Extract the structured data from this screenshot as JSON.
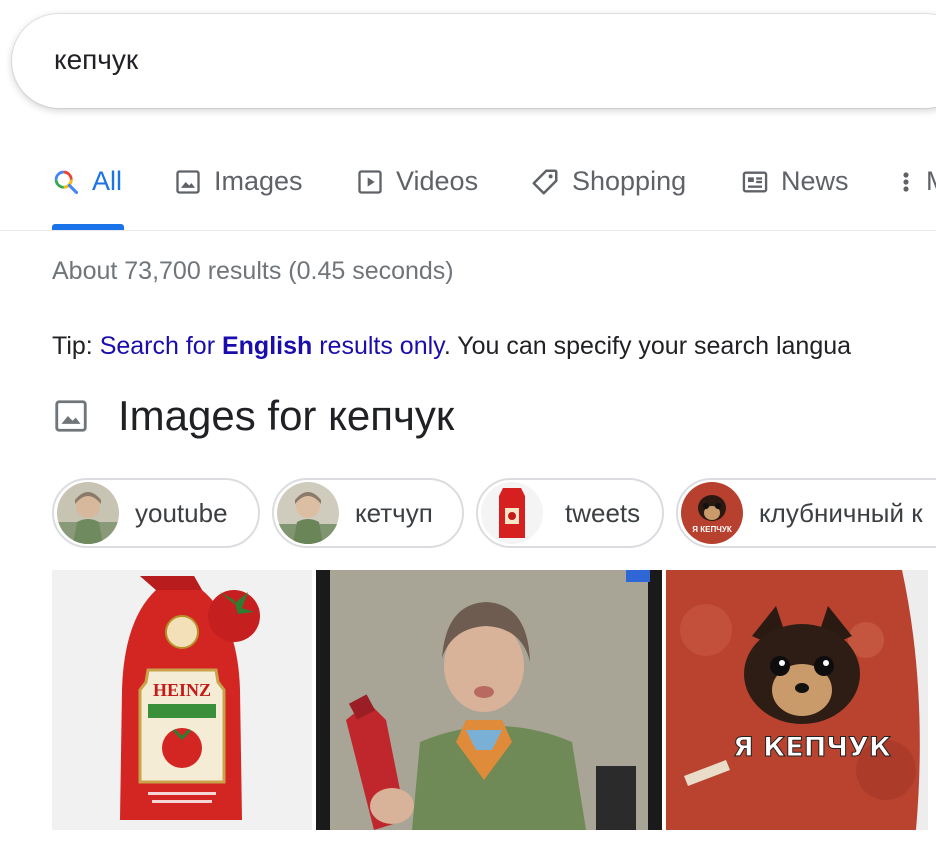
{
  "search": {
    "query": "кепчук"
  },
  "tabs": [
    {
      "label": "All",
      "icon": "search-icon",
      "active": true
    },
    {
      "label": "Images",
      "icon": "image-icon"
    },
    {
      "label": "Videos",
      "icon": "video-icon"
    },
    {
      "label": "Shopping",
      "icon": "tag-icon"
    },
    {
      "label": "News",
      "icon": "news-icon"
    },
    {
      "label": "M",
      "icon": "more-vert-icon"
    }
  ],
  "results": {
    "stats": "About 73,700 results (0.45 seconds)"
  },
  "tip": {
    "prefix": "Tip: ",
    "link_part1": "Search for ",
    "link_bold": "English",
    "link_part2": " results only",
    "suffix": ". You can specify your search langua"
  },
  "images_section": {
    "title": "Images for кепчук",
    "chips": [
      {
        "label": "youtube"
      },
      {
        "label": "кетчуп"
      },
      {
        "label": "tweets"
      },
      {
        "label": "клубничный к"
      }
    ],
    "tiles": [
      {
        "alt": "Heinz ketchup pouch",
        "brand": "HEINZ"
      },
      {
        "alt": "Woman holding ketchup bottle"
      },
      {
        "alt": "Dog in ketchup meme",
        "caption": "Я КЕПЧУК"
      }
    ]
  },
  "colors": {
    "accent": "#1a73e8",
    "link": "#1a0dab",
    "muted": "#70757a",
    "tab_text": "#5f6368"
  }
}
